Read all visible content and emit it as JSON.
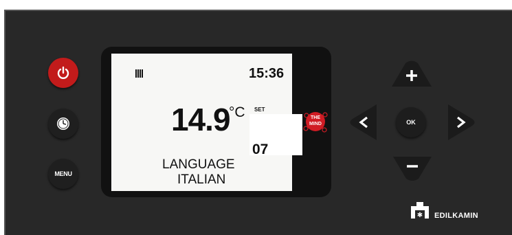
{
  "display": {
    "time": "15:36",
    "temperature": "14.9",
    "unit": "°C",
    "set_label": "SET",
    "set_value": "07",
    "menu_line1": "LANGUAGE",
    "menu_line2": "ITALIAN"
  },
  "buttons": {
    "menu_label": "MENU",
    "ok_label": "OK"
  },
  "logos": {
    "mind_line1": "THE",
    "mind_line2": "MIND",
    "brand": "EDILKAMIN"
  },
  "colors": {
    "panel": "#282828",
    "power": "#c21b1b",
    "mind_red": "#d01c24"
  },
  "icons": [
    "power-icon",
    "clock-icon",
    "signal-bars-icon",
    "brand-mark-icon"
  ]
}
